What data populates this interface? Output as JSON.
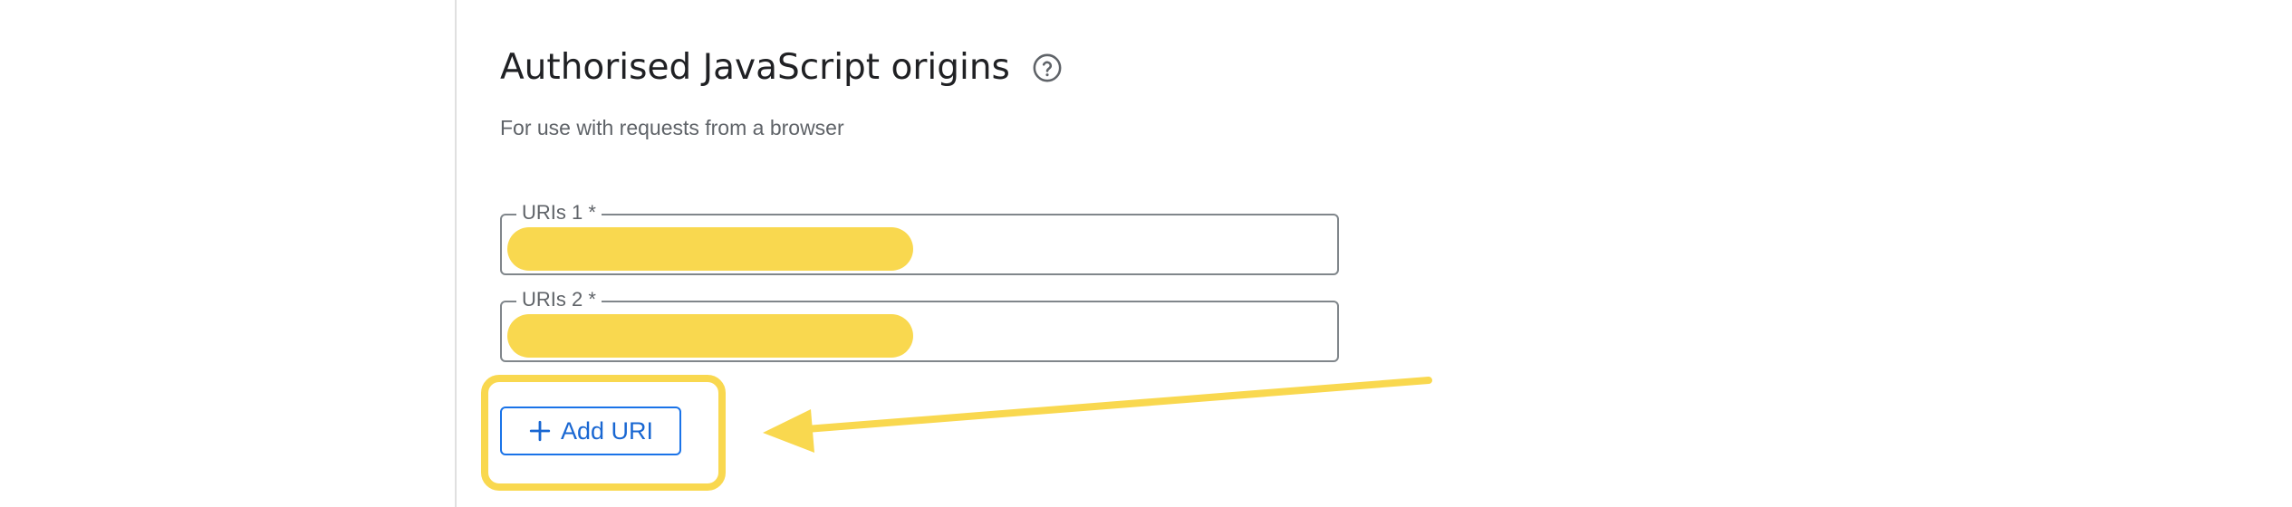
{
  "section": {
    "title": "Authorised JavaScript origins",
    "subtitle": "For use with requests from a browser",
    "help_icon": "help-circle-icon"
  },
  "fields": [
    {
      "label": "URIs 1 *",
      "value_redacted": true
    },
    {
      "label": "URIs 2 *",
      "value_redacted": true
    }
  ],
  "add_button": {
    "label": "Add URI",
    "icon": "plus-icon"
  },
  "annotation": {
    "color": "#f9d84f"
  },
  "colors": {
    "accent": "#1a73e8",
    "title_text": "#202124",
    "secondary_text": "#5f6368",
    "border": "#80868b",
    "highlight": "#f9d84f"
  }
}
